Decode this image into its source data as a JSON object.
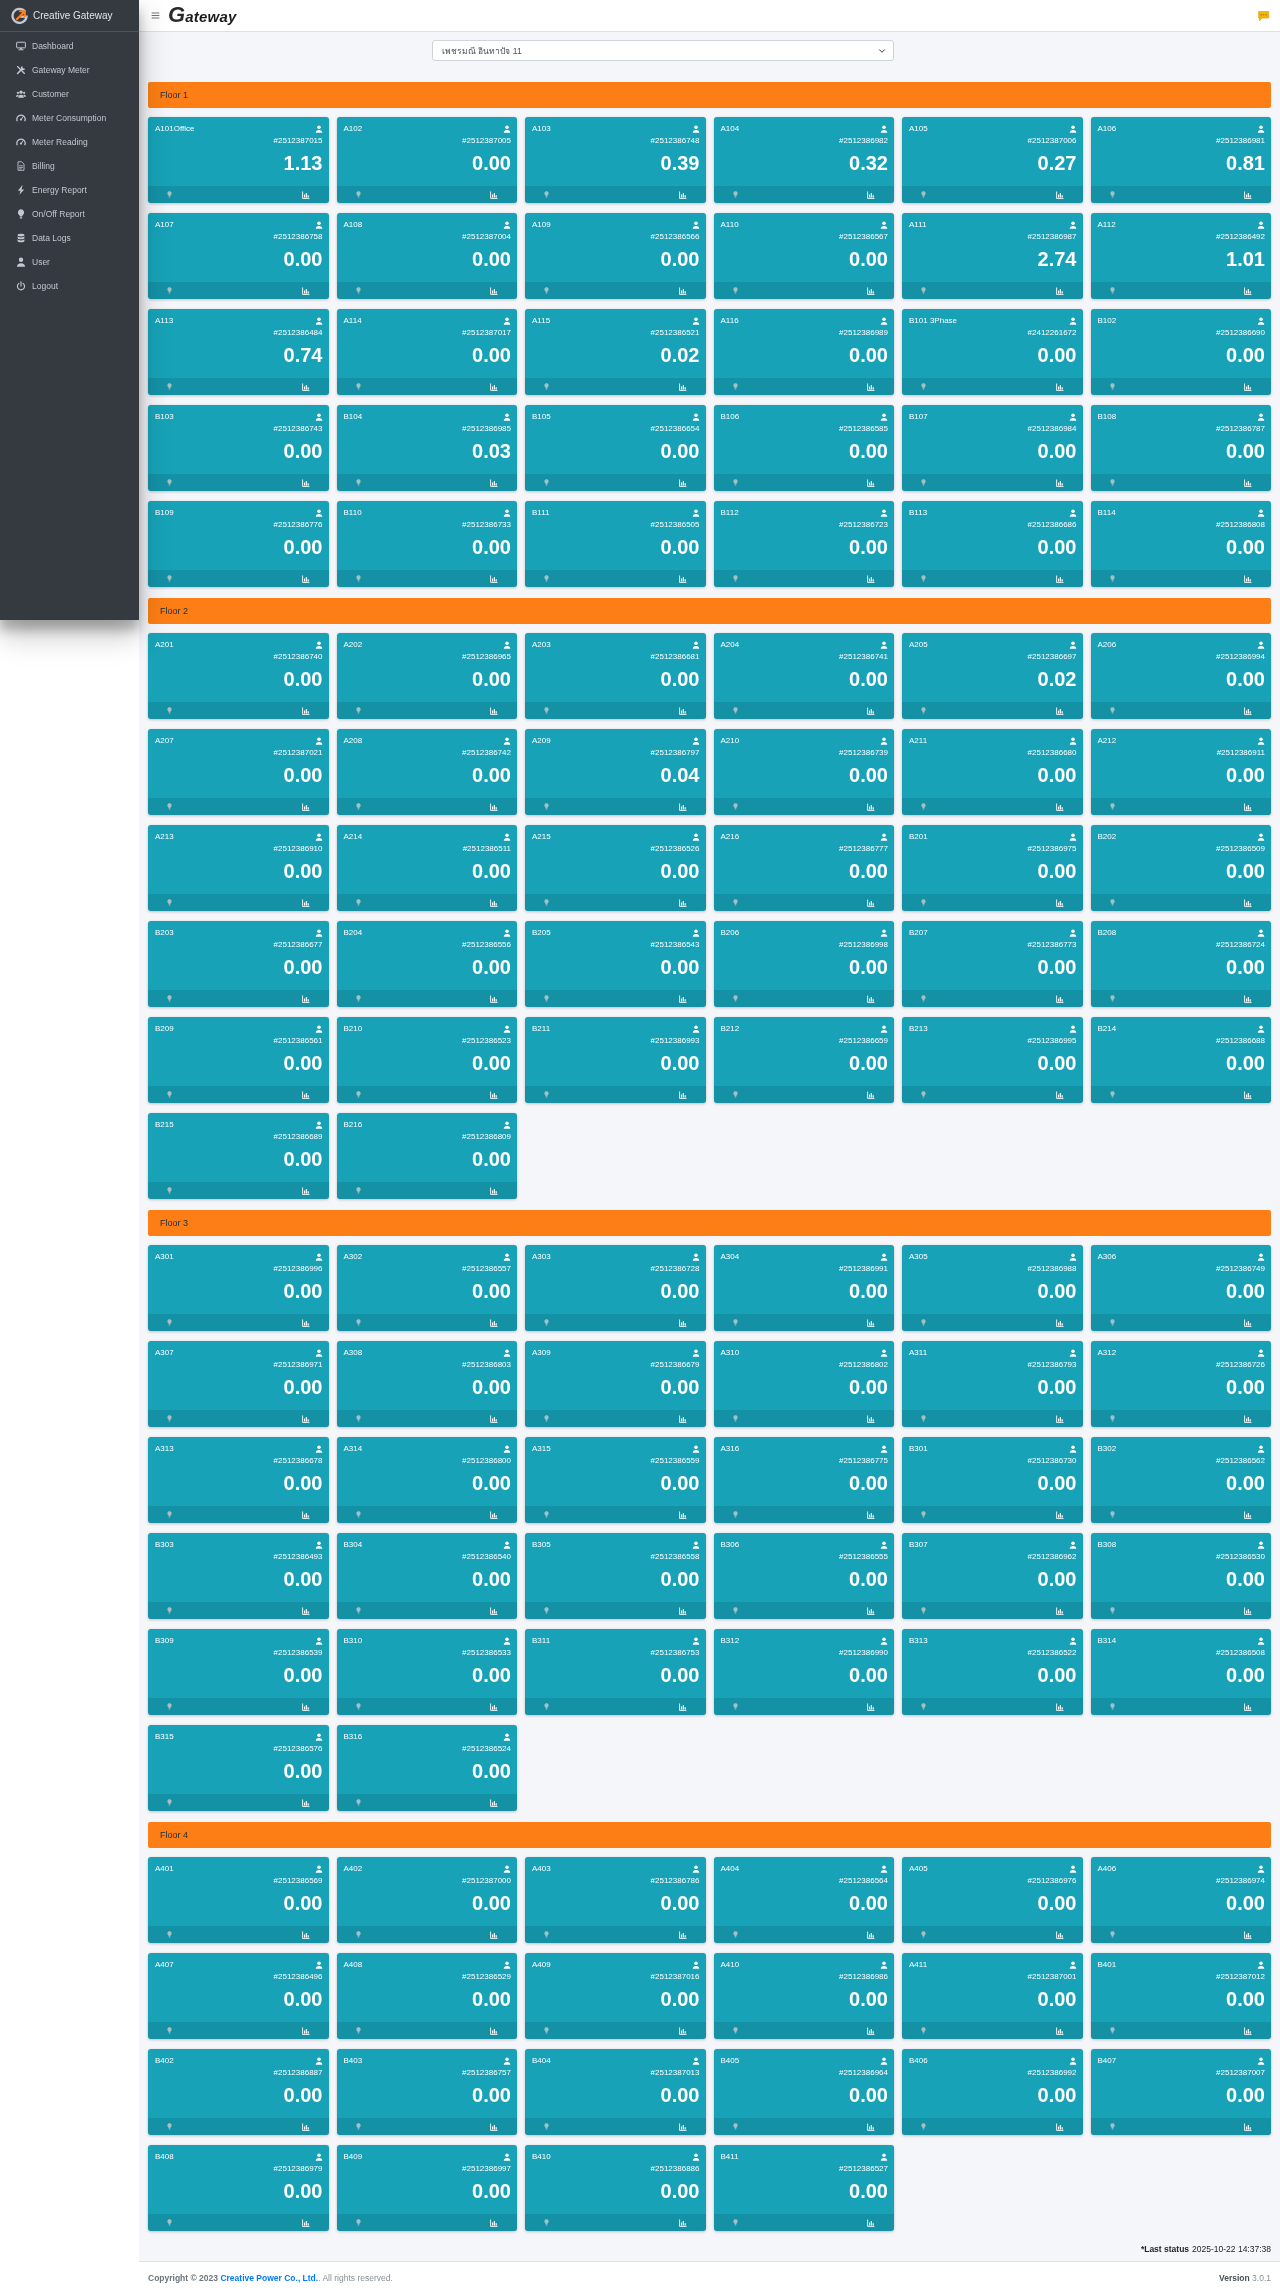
{
  "sidebar": {
    "brand": "Creative Gateway",
    "items": [
      {
        "label": "Dashboard",
        "selected": false
      },
      {
        "label": "Gateway Meter",
        "selected": false
      },
      {
        "label": "Customer",
        "selected": false
      },
      {
        "label": "Meter Consumption",
        "selected": false
      },
      {
        "label": "Meter Reading",
        "selected": false
      },
      {
        "label": "Billing",
        "selected": false
      },
      {
        "label": "Energy Report",
        "selected": false
      },
      {
        "label": "On/Off Report",
        "selected": false
      },
      {
        "label": "Data Logs",
        "selected": false
      },
      {
        "label": "User",
        "selected": false
      },
      {
        "label": "Logout",
        "selected": false
      }
    ]
  },
  "navbar": {
    "logo": "Gateway"
  },
  "site_select": {
    "value": "เพชรมณี อินทาปัจ 11"
  },
  "floors": [
    {
      "title": "Floor 1",
      "meters": [
        {
          "name": "A101Office",
          "meter_no": "#2512387015",
          "reading": "1.13",
          "lamp_on": false
        },
        {
          "name": "A102",
          "meter_no": "#2512387005",
          "reading": "0.00",
          "lamp_on": false
        },
        {
          "name": "A103",
          "meter_no": "#2512386748",
          "reading": "0.39",
          "lamp_on": false
        },
        {
          "name": "A104",
          "meter_no": "#2512386982",
          "reading": "0.32",
          "lamp_on": false
        },
        {
          "name": "A105",
          "meter_no": "#2512387006",
          "reading": "0.27",
          "lamp_on": false
        },
        {
          "name": "A106",
          "meter_no": "#2512386981",
          "reading": "0.81",
          "lamp_on": false
        },
        {
          "name": "A107",
          "meter_no": "#2512386758",
          "reading": "0.00",
          "lamp_on": false
        },
        {
          "name": "A108",
          "meter_no": "#2512387004",
          "reading": "0.00",
          "lamp_on": false
        },
        {
          "name": "A109",
          "meter_no": "#2512386566",
          "reading": "0.00",
          "lamp_on": false
        },
        {
          "name": "A110",
          "meter_no": "#2512386567",
          "reading": "0.00",
          "lamp_on": false
        },
        {
          "name": "A111",
          "meter_no": "#2512386987",
          "reading": "2.74",
          "lamp_on": false
        },
        {
          "name": "A112",
          "meter_no": "#2512386492",
          "reading": "1.01",
          "lamp_on": false
        },
        {
          "name": "A113",
          "meter_no": "#2512386484",
          "reading": "0.74",
          "lamp_on": false
        },
        {
          "name": "A114",
          "meter_no": "#2512387017",
          "reading": "0.00",
          "lamp_on": false
        },
        {
          "name": "A115",
          "meter_no": "#2512386521",
          "reading": "0.02",
          "lamp_on": false
        },
        {
          "name": "A116",
          "meter_no": "#2512386989",
          "reading": "0.00",
          "lamp_on": false
        },
        {
          "name": "B101 3Phase",
          "meter_no": "#2412261672",
          "reading": "0.00",
          "lamp_on": false
        },
        {
          "name": "B102",
          "meter_no": "#2512386690",
          "reading": "0.00",
          "lamp_on": false
        },
        {
          "name": "B103",
          "meter_no": "#2512386743",
          "reading": "0.00",
          "lamp_on": false
        },
        {
          "name": "B104",
          "meter_no": "#2512386985",
          "reading": "0.03",
          "lamp_on": false
        },
        {
          "name": "B105",
          "meter_no": "#2512386654",
          "reading": "0.00",
          "lamp_on": false
        },
        {
          "name": "B106",
          "meter_no": "#2512386585",
          "reading": "0.00",
          "lamp_on": false
        },
        {
          "name": "B107",
          "meter_no": "#2512386984",
          "reading": "0.00",
          "lamp_on": false
        },
        {
          "name": "B108",
          "meter_no": "#2512386787",
          "reading": "0.00",
          "lamp_on": false
        },
        {
          "name": "B109",
          "meter_no": "#2512386776",
          "reading": "0.00",
          "lamp_on": false
        },
        {
          "name": "B110",
          "meter_no": "#2512386733",
          "reading": "0.00",
          "lamp_on": false
        },
        {
          "name": "B111",
          "meter_no": "#2512386505",
          "reading": "0.00",
          "lamp_on": false
        },
        {
          "name": "B112",
          "meter_no": "#2512386723",
          "reading": "0.00",
          "lamp_on": false
        },
        {
          "name": "B113",
          "meter_no": "#2512386686",
          "reading": "0.00",
          "lamp_on": false
        },
        {
          "name": "B114",
          "meter_no": "#2512386808",
          "reading": "0.00",
          "lamp_on": false
        }
      ]
    },
    {
      "title": "Floor 2",
      "meters": [
        {
          "name": "A201",
          "meter_no": "#2512386740",
          "reading": "0.00",
          "lamp_on": false
        },
        {
          "name": "A202",
          "meter_no": "#2512386965",
          "reading": "0.00",
          "lamp_on": false
        },
        {
          "name": "A203",
          "meter_no": "#2512386681",
          "reading": "0.00",
          "lamp_on": false
        },
        {
          "name": "A204",
          "meter_no": "#2512386741",
          "reading": "0.00",
          "lamp_on": false
        },
        {
          "name": "A205",
          "meter_no": "#2512386697",
          "reading": "0.02",
          "lamp_on": false
        },
        {
          "name": "A206",
          "meter_no": "#2512386994",
          "reading": "0.00",
          "lamp_on": false
        },
        {
          "name": "A207",
          "meter_no": "#2512387021",
          "reading": "0.00",
          "lamp_on": false
        },
        {
          "name": "A208",
          "meter_no": "#2512386742",
          "reading": "0.00",
          "lamp_on": false
        },
        {
          "name": "A209",
          "meter_no": "#2512386797",
          "reading": "0.04",
          "lamp_on": false
        },
        {
          "name": "A210",
          "meter_no": "#2512386739",
          "reading": "0.00",
          "lamp_on": false
        },
        {
          "name": "A211",
          "meter_no": "#2512386680",
          "reading": "0.00",
          "lamp_on": false
        },
        {
          "name": "A212",
          "meter_no": "#2512386911",
          "reading": "0.00",
          "lamp_on": false
        },
        {
          "name": "A213",
          "meter_no": "#2512386910",
          "reading": "0.00",
          "lamp_on": false
        },
        {
          "name": "A214",
          "meter_no": "#2512386511",
          "reading": "0.00",
          "lamp_on": false
        },
        {
          "name": "A215",
          "meter_no": "#2512386526",
          "reading": "0.00",
          "lamp_on": false
        },
        {
          "name": "A216",
          "meter_no": "#2512386777",
          "reading": "0.00",
          "lamp_on": false
        },
        {
          "name": "B201",
          "meter_no": "#2512386975",
          "reading": "0.00",
          "lamp_on": false
        },
        {
          "name": "B202",
          "meter_no": "#2512386509",
          "reading": "0.00",
          "lamp_on": false
        },
        {
          "name": "B203",
          "meter_no": "#2512386677",
          "reading": "0.00",
          "lamp_on": false
        },
        {
          "name": "B204",
          "meter_no": "#2512386556",
          "reading": "0.00",
          "lamp_on": false
        },
        {
          "name": "B205",
          "meter_no": "#2512386543",
          "reading": "0.00",
          "lamp_on": false
        },
        {
          "name": "B206",
          "meter_no": "#2512386998",
          "reading": "0.00",
          "lamp_on": false
        },
        {
          "name": "B207",
          "meter_no": "#2512386773",
          "reading": "0.00",
          "lamp_on": false
        },
        {
          "name": "B208",
          "meter_no": "#2512386724",
          "reading": "0.00",
          "lamp_on": false
        },
        {
          "name": "B209",
          "meter_no": "#2512386561",
          "reading": "0.00",
          "lamp_on": false
        },
        {
          "name": "B210",
          "meter_no": "#2512386523",
          "reading": "0.00",
          "lamp_on": false
        },
        {
          "name": "B211",
          "meter_no": "#2512386993",
          "reading": "0.00",
          "lamp_on": false
        },
        {
          "name": "B212",
          "meter_no": "#2512386659",
          "reading": "0.00",
          "lamp_on": false
        },
        {
          "name": "B213",
          "meter_no": "#2512386995",
          "reading": "0.00",
          "lamp_on": false
        },
        {
          "name": "B214",
          "meter_no": "#2512386688",
          "reading": "0.00",
          "lamp_on": false
        },
        {
          "name": "B215",
          "meter_no": "#2512386689",
          "reading": "0.00",
          "lamp_on": false
        },
        {
          "name": "B216",
          "meter_no": "#2512386809",
          "reading": "0.00",
          "lamp_on": false
        }
      ]
    },
    {
      "title": "Floor 3",
      "meters": [
        {
          "name": "A301",
          "meter_no": "#2512386996",
          "reading": "0.00",
          "lamp_on": false
        },
        {
          "name": "A302",
          "meter_no": "#2512386557",
          "reading": "0.00",
          "lamp_on": false
        },
        {
          "name": "A303",
          "meter_no": "#2512386728",
          "reading": "0.00",
          "lamp_on": false
        },
        {
          "name": "A304",
          "meter_no": "#2512386991",
          "reading": "0.00",
          "lamp_on": false
        },
        {
          "name": "A305",
          "meter_no": "#2512386988",
          "reading": "0.00",
          "lamp_on": false
        },
        {
          "name": "A306",
          "meter_no": "#2512386749",
          "reading": "0.00",
          "lamp_on": false
        },
        {
          "name": "A307",
          "meter_no": "#2512386971",
          "reading": "0.00",
          "lamp_on": false
        },
        {
          "name": "A308",
          "meter_no": "#2512386803",
          "reading": "0.00",
          "lamp_on": false
        },
        {
          "name": "A309",
          "meter_no": "#2512386679",
          "reading": "0.00",
          "lamp_on": false
        },
        {
          "name": "A310",
          "meter_no": "#2512386802",
          "reading": "0.00",
          "lamp_on": false
        },
        {
          "name": "A311",
          "meter_no": "#2512386793",
          "reading": "0.00",
          "lamp_on": false
        },
        {
          "name": "A312",
          "meter_no": "#2512386726",
          "reading": "0.00",
          "lamp_on": false
        },
        {
          "name": "A313",
          "meter_no": "#2512386678",
          "reading": "0.00",
          "lamp_on": false
        },
        {
          "name": "A314",
          "meter_no": "#2512386800",
          "reading": "0.00",
          "lamp_on": false
        },
        {
          "name": "A315",
          "meter_no": "#2512386559",
          "reading": "0.00",
          "lamp_on": false
        },
        {
          "name": "A316",
          "meter_no": "#2512386775",
          "reading": "0.00",
          "lamp_on": false
        },
        {
          "name": "B301",
          "meter_no": "#2512386730",
          "reading": "0.00",
          "lamp_on": false
        },
        {
          "name": "B302",
          "meter_no": "#2512386562",
          "reading": "0.00",
          "lamp_on": false
        },
        {
          "name": "B303",
          "meter_no": "#2512386493",
          "reading": "0.00",
          "lamp_on": false
        },
        {
          "name": "B304",
          "meter_no": "#2512386540",
          "reading": "0.00",
          "lamp_on": false
        },
        {
          "name": "B305",
          "meter_no": "#2512386558",
          "reading": "0.00",
          "lamp_on": false
        },
        {
          "name": "B306",
          "meter_no": "#2512386555",
          "reading": "0.00",
          "lamp_on": false
        },
        {
          "name": "B307",
          "meter_no": "#2512386962",
          "reading": "0.00",
          "lamp_on": false
        },
        {
          "name": "B308",
          "meter_no": "#2512386530",
          "reading": "0.00",
          "lamp_on": false
        },
        {
          "name": "B309",
          "meter_no": "#2512386539",
          "reading": "0.00",
          "lamp_on": false
        },
        {
          "name": "B310",
          "meter_no": "#2512386533",
          "reading": "0.00",
          "lamp_on": false
        },
        {
          "name": "B311",
          "meter_no": "#2512386753",
          "reading": "0.00",
          "lamp_on": false
        },
        {
          "name": "B312",
          "meter_no": "#2512386990",
          "reading": "0.00",
          "lamp_on": false
        },
        {
          "name": "B313",
          "meter_no": "#2512386522",
          "reading": "0.00",
          "lamp_on": false
        },
        {
          "name": "B314",
          "meter_no": "#2512386508",
          "reading": "0.00",
          "lamp_on": false
        },
        {
          "name": "B315",
          "meter_no": "#2512386576",
          "reading": "0.00",
          "lamp_on": false
        },
        {
          "name": "B316",
          "meter_no": "#2512386524",
          "reading": "0.00",
          "lamp_on": false
        }
      ]
    },
    {
      "title": "Floor 4",
      "meters": [
        {
          "name": "A401",
          "meter_no": "#2512386569",
          "reading": "0.00",
          "lamp_on": false
        },
        {
          "name": "A402",
          "meter_no": "#2512387000",
          "reading": "0.00",
          "lamp_on": false
        },
        {
          "name": "A403",
          "meter_no": "#2512386786",
          "reading": "0.00",
          "lamp_on": false
        },
        {
          "name": "A404",
          "meter_no": "#2512386564",
          "reading": "0.00",
          "lamp_on": false
        },
        {
          "name": "A405",
          "meter_no": "#2512386976",
          "reading": "0.00",
          "lamp_on": false
        },
        {
          "name": "A406",
          "meter_no": "#2512386974",
          "reading": "0.00",
          "lamp_on": false
        },
        {
          "name": "A407",
          "meter_no": "#2512386496",
          "reading": "0.00",
          "lamp_on": false
        },
        {
          "name": "A408",
          "meter_no": "#2512386529",
          "reading": "0.00",
          "lamp_on": false
        },
        {
          "name": "A409",
          "meter_no": "#2512387016",
          "reading": "0.00",
          "lamp_on": false
        },
        {
          "name": "A410",
          "meter_no": "#2512386986",
          "reading": "0.00",
          "lamp_on": false
        },
        {
          "name": "A411",
          "meter_no": "#2512387001",
          "reading": "0.00",
          "lamp_on": false
        },
        {
          "name": "B401",
          "meter_no": "#2512387012",
          "reading": "0.00",
          "lamp_on": false
        },
        {
          "name": "B402",
          "meter_no": "#2512386887",
          "reading": "0.00",
          "lamp_on": false
        },
        {
          "name": "B403",
          "meter_no": "#2512386757",
          "reading": "0.00",
          "lamp_on": false
        },
        {
          "name": "B404",
          "meter_no": "#2512387013",
          "reading": "0.00",
          "lamp_on": false
        },
        {
          "name": "B405",
          "meter_no": "#2512386964",
          "reading": "0.00",
          "lamp_on": false
        },
        {
          "name": "B406",
          "meter_no": "#2512386992",
          "reading": "0.00",
          "lamp_on": false
        },
        {
          "name": "B407",
          "meter_no": "#2512387007",
          "reading": "0.00",
          "lamp_on": false
        },
        {
          "name": "B408",
          "meter_no": "#2512386979",
          "reading": "0.00",
          "lamp_on": false
        },
        {
          "name": "B409",
          "meter_no": "#2512386997",
          "reading": "0.00",
          "lamp_on": false
        },
        {
          "name": "B410",
          "meter_no": "#2512386886",
          "reading": "0.00",
          "lamp_on": false
        },
        {
          "name": "B411",
          "meter_no": "#2512386527",
          "reading": "0.00",
          "lamp_on": false
        }
      ]
    }
  ],
  "last_status": {
    "label": "*Last status",
    "time": "2025-10-22 14:37:38"
  },
  "footer": {
    "copyright": "Copyright © 2023",
    "company_link": "Creative Power Co., Ltd.",
    "rights": ". All rights reserved.",
    "version_label": "Version",
    "version": "3.0.1"
  }
}
